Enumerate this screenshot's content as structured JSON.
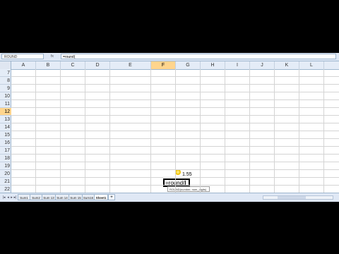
{
  "formula_bar": {
    "name_box": "ROUND",
    "fx_label": "fx",
    "formula": "=round("
  },
  "columns": [
    "A",
    "B",
    "C",
    "D",
    "E",
    "F",
    "G",
    "H",
    "I",
    "J",
    "K",
    "L"
  ],
  "active_column": "F",
  "rows": [
    "7",
    "8",
    "9",
    "10",
    "11",
    "12",
    "13",
    "14",
    "15",
    "16",
    "17",
    "18",
    "19",
    "20",
    "21",
    "22"
  ],
  "active_row": "12",
  "cells": {
    "F11": "1.55",
    "F12_editing": "=round("
  },
  "tooltip": "ROUND(number, num_digits)",
  "sheet_tabs": [
    "Sum1",
    "Sum2",
    "Sum 13",
    "Sum 14",
    "Sum 15",
    "Sum16",
    "Sheet1"
  ],
  "active_tab": "Sheet1",
  "add_tab_label": "+",
  "colors": {
    "header_bg": "#e4ecf7",
    "active_header": "#ffd58d",
    "grid": "#d4d4d4"
  }
}
